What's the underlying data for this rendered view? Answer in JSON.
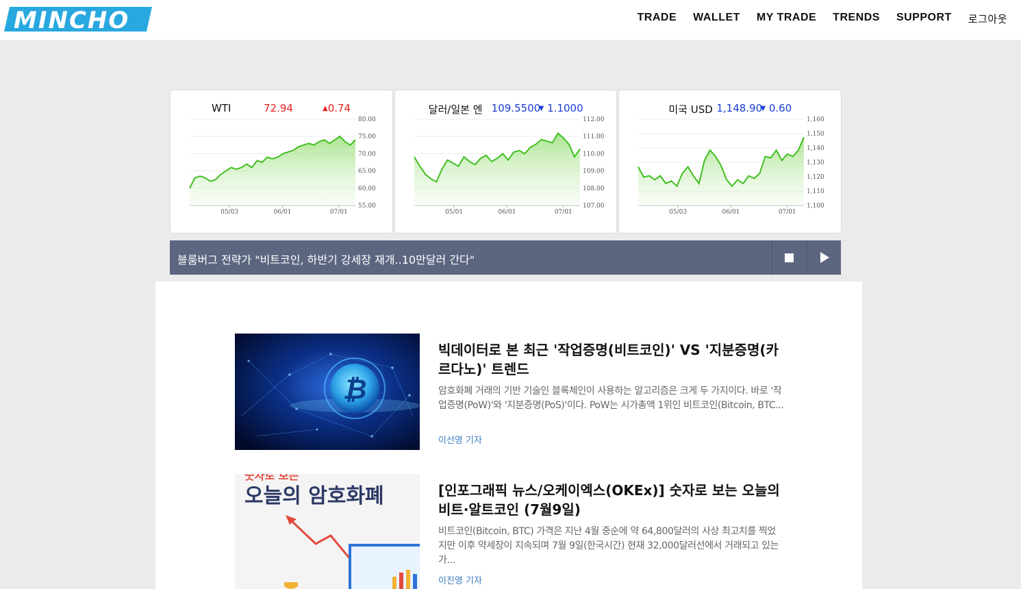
{
  "header": {
    "logo_text": "MINCHO",
    "nav": [
      "TRADE",
      "WALLET",
      "MY TRADE",
      "TRENDS",
      "SUPPORT",
      "로그아웃"
    ]
  },
  "colors": {
    "up": "#e52020",
    "down": "#1a3dd6",
    "line": "#3fbf1f",
    "newsbar": "#5c6680"
  },
  "tickers": [
    {
      "name": "WTI",
      "value": "72.94",
      "change": "0.74",
      "direction": "up",
      "chart_data": {
        "type": "area",
        "x_ticks": [
          "05/03",
          "06/01",
          "07/01"
        ],
        "y_ticks": [
          "80.00",
          "75.00",
          "70.00",
          "65.00",
          "60.00",
          "55.00"
        ],
        "ylim": [
          55,
          80
        ],
        "values": [
          60,
          63,
          63.5,
          63,
          62,
          62.5,
          64,
          65,
          66,
          65.5,
          66,
          67,
          66,
          68,
          67.5,
          69,
          68.5,
          69,
          70,
          70.5,
          71,
          72,
          72.5,
          73,
          72.5,
          73.5,
          74,
          73,
          74,
          75,
          73.5,
          72.5,
          74
        ]
      }
    },
    {
      "name": "달러/일본 엔",
      "value": "109.5500",
      "change": "1.1000",
      "direction": "down",
      "chart_data": {
        "type": "area",
        "x_ticks": [
          "05/01",
          "06/01",
          "07/01"
        ],
        "y_ticks": [
          "112.00",
          "111.00",
          "110.00",
          "109.00",
          "108.00",
          "107.00"
        ],
        "ylim": [
          106.5,
          112
        ],
        "values": [
          109.6,
          109,
          108.5,
          108.2,
          108,
          108.8,
          109.4,
          109.2,
          109,
          109.6,
          109.3,
          109.1,
          109.5,
          109.7,
          109.3,
          109.5,
          109.8,
          109.4,
          109.9,
          110,
          109.8,
          110.2,
          110.4,
          110.7,
          110.6,
          110.5,
          111.1,
          110.8,
          110.4,
          109.6,
          110.1
        ]
      }
    },
    {
      "name": "미국 USD",
      "value": "1,148.90",
      "change": "0.60",
      "direction": "down",
      "chart_data": {
        "type": "area",
        "x_ticks": [
          "05/03",
          "06/01",
          "07/01"
        ],
        "y_ticks": [
          "1,160",
          "1,150",
          "1,140",
          "1,130",
          "1,120",
          "1,110",
          "1,100"
        ],
        "ylim": [
          1095,
          1162
        ],
        "values": [
          1125,
          1117,
          1118,
          1115,
          1118,
          1112,
          1114,
          1110,
          1120,
          1125,
          1118,
          1112,
          1130,
          1138,
          1133,
          1126,
          1115,
          1110,
          1115,
          1112,
          1118,
          1116,
          1120,
          1133,
          1132,
          1138,
          1130,
          1135,
          1133,
          1138,
          1148
        ]
      }
    }
  ],
  "newsbar": {
    "headline": "블룸버그 전략가 \"비트코인, 하반기 강세장 재개..10만달러 간다\""
  },
  "articles": [
    {
      "title": "빅데이터로 본 최근 '작업증명(비트코인)' VS '지분증명(카르다노)' 트렌드",
      "body": "암호화폐 거래의 기반 기술인 블록체인이 사용하는 알고리즘은 크게 두 가지이다. 바로 '작업증명(PoW)'와 '지분증명(PoS)'이다. PoW는 시가총액 1위인 비트코인(Bitcoin, BTC...",
      "author": "이선영 기자"
    },
    {
      "title": "[인포그래픽 뉴스/오케이엑스(OKEx)] 숫자로 보는 오늘의 비트·알트코인 (7월9일)",
      "body": "비트코인(Bitcoin, BTC) 가격은 지난 4월 중순에 약 64,800달러의 사상 최고치를 찍었지만 이후 약세장이 지속되며 7월 9일(한국시간) 현재 32,000달러선에서 거래되고 있는 가...",
      "author": "이진영 기자",
      "thumb_title": "오늘의 암호화폐",
      "thumb_subtitle": "숫자로 보는"
    }
  ]
}
